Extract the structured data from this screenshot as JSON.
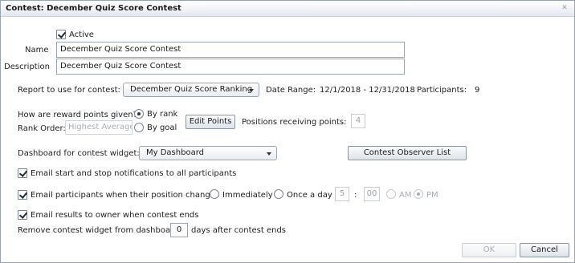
{
  "dialog": {
    "title": "Contest: December Quiz Score Contest"
  },
  "form": {
    "active_label": "Active",
    "active_checked": true,
    "name_label": "Name",
    "name_value": "December Quiz Score Contest",
    "description_label": "Description",
    "description_value": "December Quiz Score Contest",
    "report_label": "Report to use for contest:",
    "report_value": "December Quiz Score Ranking",
    "date_range_label": "Date Range:",
    "date_range_value": "12/1/2018 - 12/31/2018",
    "participants_label": "Participants:",
    "participants_value": "9",
    "reward_label": "How are reward points given?",
    "by_rank_label": "By rank",
    "by_goal_label": "By goal",
    "reward_mode": "rank",
    "rank_order_label": "Rank Order:",
    "rank_order_value": "Highest Average",
    "edit_points_label": "Edit Points",
    "positions_label": "Positions receiving points:",
    "positions_value": "4",
    "dashboard_label": "Dashboard for contest widget:",
    "dashboard_value": "My Dashboard",
    "observer_list_label": "Contest Observer List",
    "email_start_stop_label": "Email start and stop notifications to all participants",
    "email_position_label": "Email participants when their position changes",
    "immediately_label": "Immediately",
    "once_a_day_label": "Once a day",
    "hour_value": "5",
    "time_separator": ":",
    "minute_value": "00",
    "am_label": "AM",
    "pm_label": "PM",
    "email_results_label": "Email results to owner when contest ends",
    "remove_widget_label": "Remove contest widget from dashboard:",
    "remove_widget_days": "0",
    "remove_widget_suffix": "days after contest ends"
  },
  "footer": {
    "ok_label": "OK",
    "cancel_label": "Cancel"
  },
  "icons": {
    "close": "close-icon",
    "dropdown": "chevron-down-icon"
  }
}
